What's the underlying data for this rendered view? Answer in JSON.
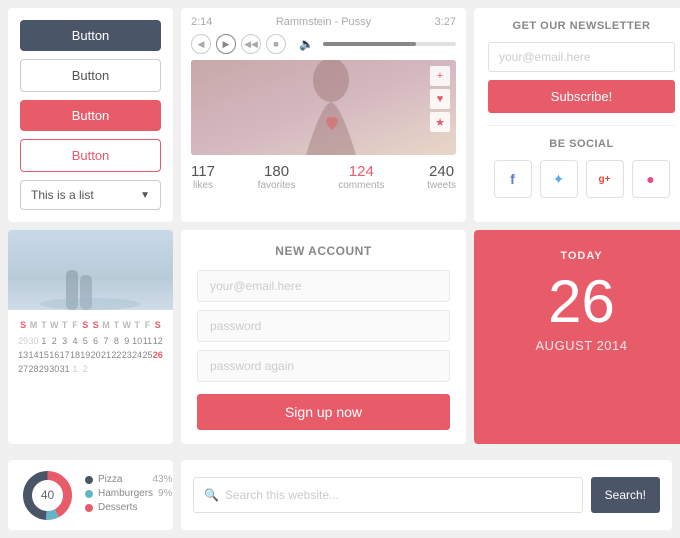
{
  "buttons": {
    "btn1_label": "Button",
    "btn2_label": "Button",
    "btn3_label": "Button",
    "btn4_label": "Button",
    "dropdown_label": "This is a list"
  },
  "player": {
    "time_current": "2:14",
    "time_total": "3:27",
    "track_title": "Rammstein - Pussy",
    "stats": [
      {
        "number": "117",
        "label": "likes",
        "highlight": false
      },
      {
        "number": "180",
        "label": "favorites",
        "highlight": false
      },
      {
        "number": "124",
        "label": "comments",
        "highlight": true
      },
      {
        "number": "240",
        "label": "tweets",
        "highlight": false
      }
    ]
  },
  "newsletter": {
    "title": "GET OUR NEWSLETTER",
    "input_placeholder": "your@email.here",
    "subscribe_label": "Subscribe!",
    "social_title": "BE SOCIAL"
  },
  "calendar": {
    "day_names_1": [
      "S",
      "M",
      "T",
      "W",
      "T",
      "F",
      "S"
    ],
    "day_names_2": [
      "S",
      "M",
      "T",
      "W",
      "T",
      "F",
      "S"
    ],
    "weeks": [
      [
        "29",
        "30",
        "1",
        "2",
        "3",
        "4",
        "5",
        "6",
        "7",
        "8",
        "9",
        "10",
        "11",
        "12"
      ],
      [
        "13",
        "14",
        "15",
        "16",
        "17",
        "18",
        "19",
        "20",
        "21",
        "22",
        "23",
        "24",
        "25",
        "26"
      ],
      [
        "27",
        "28",
        "29",
        "30",
        "31",
        "1",
        "2"
      ]
    ],
    "highlight_date": "26"
  },
  "account": {
    "title": "NEW ACCOUNT",
    "email_placeholder": "your@email.here",
    "password_placeholder": "password",
    "password2_placeholder": "password again",
    "signup_label": "Sign up now"
  },
  "today": {
    "label": "TODAY",
    "number": "26",
    "month": "AUGUST 2014"
  },
  "donut": {
    "items": [
      {
        "label": "Pizza",
        "pct": "43%",
        "color": "#4a5568"
      },
      {
        "label": "Hamburgers",
        "pct": "9%",
        "color": "#64b4c8"
      },
      {
        "label": "Desserts",
        "pct": "...",
        "color": "#e85c6a"
      }
    ],
    "center_number": "40"
  },
  "search": {
    "placeholder": "Search this website...",
    "button_label": "Search!"
  },
  "social_icons": [
    "f",
    "t",
    "g+",
    "☯"
  ],
  "colors": {
    "accent": "#e85c6a",
    "dark": "#4a5568",
    "muted": "#aaa"
  }
}
